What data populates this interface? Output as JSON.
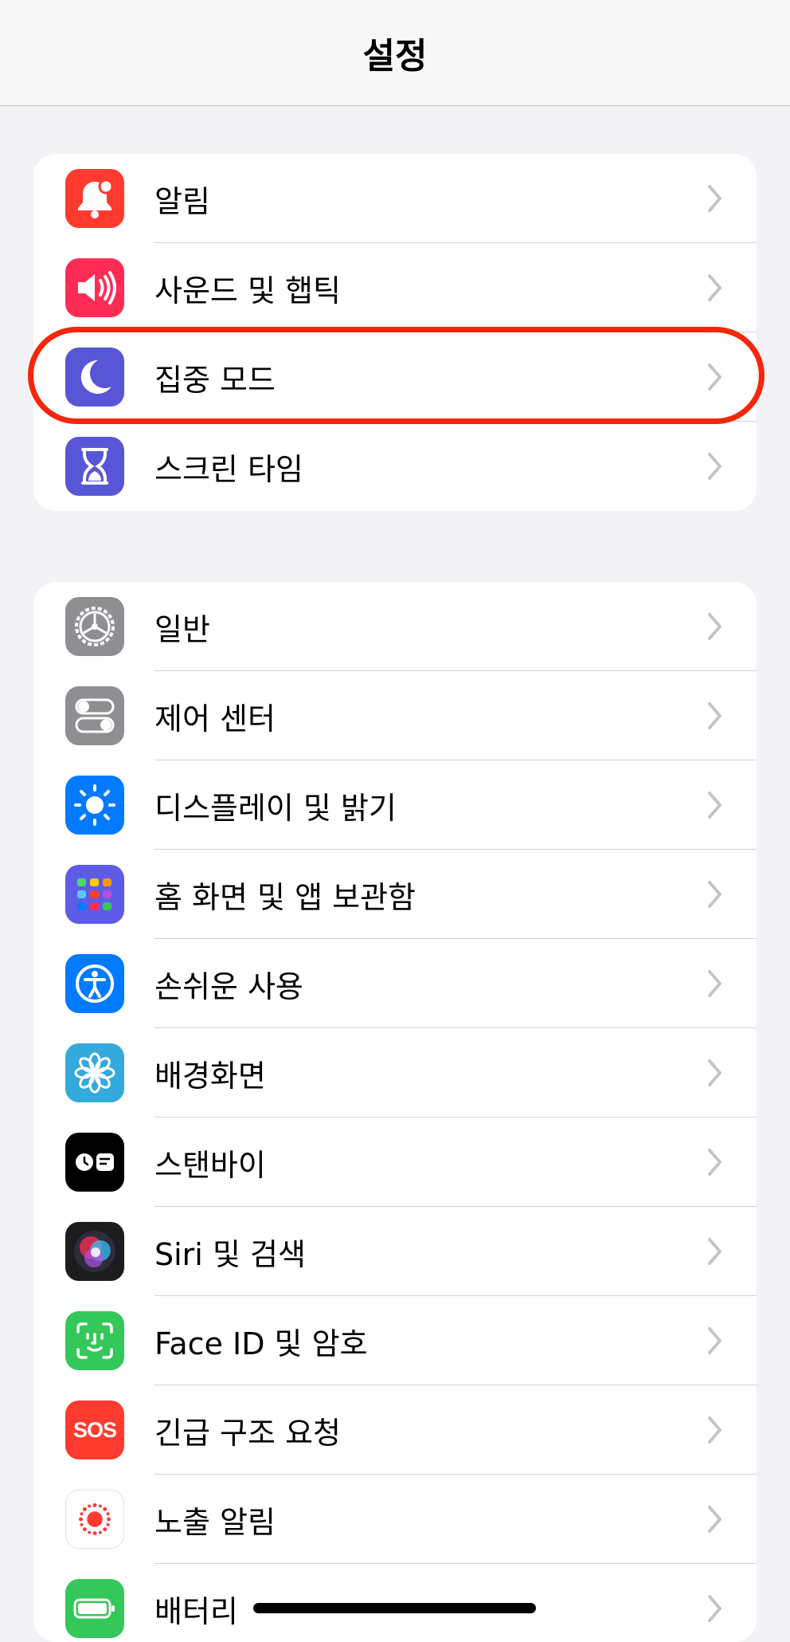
{
  "header": {
    "title": "설정"
  },
  "group1": [
    {
      "label": "알림",
      "icon": "bell-icon",
      "color": "#ff3b30"
    },
    {
      "label": "사운드 및 햅틱",
      "icon": "speaker-icon",
      "color": "#ff2d55"
    },
    {
      "label": "집중 모드",
      "icon": "moon-icon",
      "color": "#5856d6",
      "highlighted": true
    },
    {
      "label": "스크린 타임",
      "icon": "hourglass-icon",
      "color": "#5856d6"
    }
  ],
  "group2": [
    {
      "label": "일반",
      "icon": "gear-icon",
      "color": "#8e8e93"
    },
    {
      "label": "제어 센터",
      "icon": "toggles-icon",
      "color": "#8e8e93"
    },
    {
      "label": "디스플레이 및 밝기",
      "icon": "sun-icon",
      "color": "#007aff"
    },
    {
      "label": "홈 화면 및 앱 보관함",
      "icon": "app-grid-icon",
      "color": "#5e5ce6"
    },
    {
      "label": "손쉬운 사용",
      "icon": "accessibility-icon",
      "color": "#007aff"
    },
    {
      "label": "배경화면",
      "icon": "flower-icon",
      "color": "#34aadc"
    },
    {
      "label": "스탠바이",
      "icon": "standby-icon",
      "color": "#000000"
    },
    {
      "label": "Siri 및 검색",
      "icon": "siri-icon",
      "color": "#1c1c1e"
    },
    {
      "label": "Face ID 및 암호",
      "icon": "face-id-icon",
      "color": "#34c759"
    },
    {
      "label": "긴급 구조 요청",
      "icon": "sos-icon",
      "color": "#ff3b30",
      "icon_text": "SOS"
    },
    {
      "label": "노출 알림",
      "icon": "exposure-icon",
      "color": "#ffffff"
    },
    {
      "label": "배터리",
      "icon": "battery-icon",
      "color": "#34c759"
    }
  ]
}
